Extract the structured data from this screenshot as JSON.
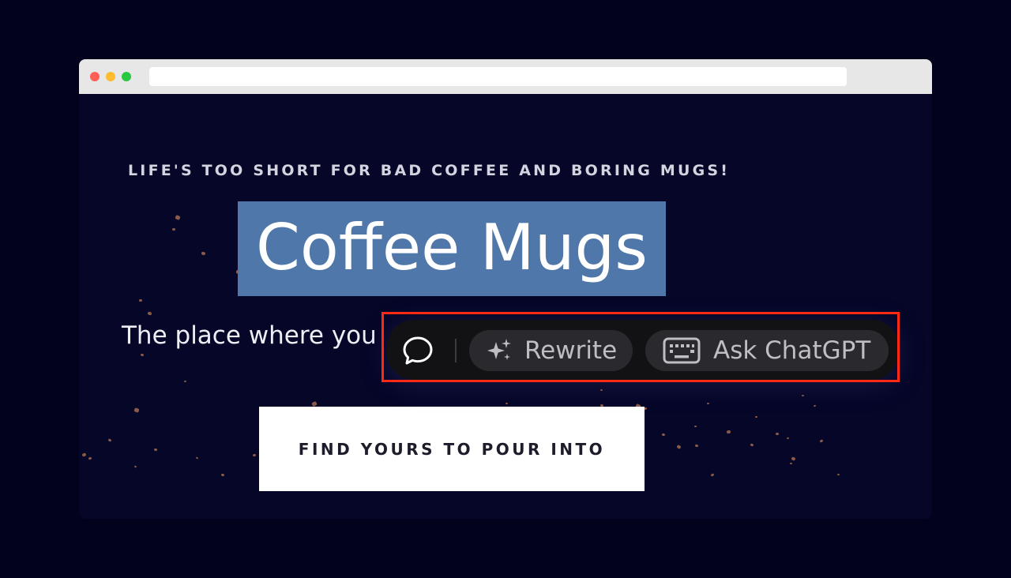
{
  "page": {
    "tagline": "LIFE'S TOO SHORT FOR BAD COFFEE AND BORING MUGS!",
    "headline": "Coffee Mugs",
    "subheadline": "The place where you",
    "cta_label": "FIND YOURS TO POUR INTO"
  },
  "toolbar": {
    "chat_icon": "chat-bubble-icon",
    "rewrite_icon": "sparkles-icon",
    "rewrite_label": "Rewrite",
    "ask_icon": "keyboard-icon",
    "ask_label": "Ask ChatGPT"
  },
  "colors": {
    "background": "#03021c",
    "page_background": "#050628",
    "selection_highlight": "#5077a9",
    "toolbar_background": "#121215",
    "pill_background": "#2a2a2e",
    "highlight_border": "#ff2a13"
  }
}
